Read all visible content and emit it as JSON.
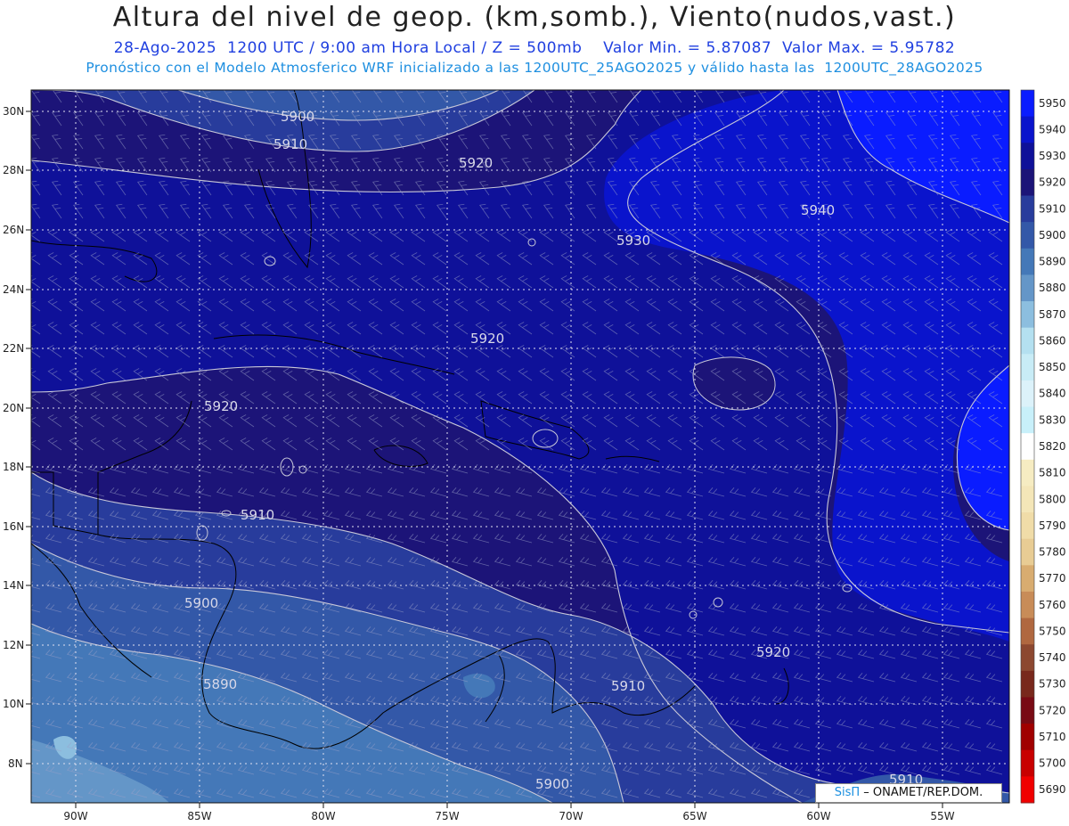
{
  "header": {
    "title": "Altura del nivel de geop. (km,somb.), Viento(nudos,vast.)",
    "subtitle": "28-Ago-2025  1200 UTC / 9:00 am Hora Local / Z = 500mb    Valor Min. = 5.87087  Valor Max. = 5.95782",
    "model_line": "Pronóstico con el Modelo Atmosferico WRF inicializado a las 1200UTC_25AGO2025 y válido hasta las  1200UTC_28AGO2025"
  },
  "axes": {
    "lat_labels": [
      "30N",
      "28N",
      "26N",
      "24N",
      "22N",
      "20N",
      "18N",
      "16N",
      "14N",
      "12N",
      "10N",
      "8N"
    ],
    "lon_labels": [
      "90W",
      "85W",
      "80W",
      "75W",
      "70W",
      "65W",
      "60W",
      "55W"
    ]
  },
  "contour_labels": [
    "5900",
    "5910",
    "5920",
    "5940",
    "5930",
    "5920",
    "5920",
    "5910",
    "5900",
    "5890",
    "5920",
    "5910",
    "5900",
    "5910"
  ],
  "colorbar": {
    "levels": [
      "5950",
      "5940",
      "5930",
      "5920",
      "5910",
      "5900",
      "5890",
      "5880",
      "5870",
      "5860",
      "5850",
      "5840",
      "5830",
      "5820",
      "5810",
      "5800",
      "5790",
      "5780",
      "5770",
      "5760",
      "5750",
      "5740",
      "5730",
      "5720",
      "5710",
      "5700",
      "5690"
    ],
    "colors": [
      "#0a1cff",
      "#0a14cc",
      "#0f1199",
      "#1c1478",
      "#283c9c",
      "#3358a8",
      "#4478b8",
      "#6496c8",
      "#8cbedf",
      "#b4e0f0",
      "#c8ecf6",
      "#dcf2fa",
      "#c8f0fa",
      "#ffffff",
      "#f6ecc2",
      "#f4e6b8",
      "#f0dca8",
      "#e8cc94",
      "#d8ac70",
      "#c88c58",
      "#b06840",
      "#8c4830",
      "#78281c",
      "#780a14",
      "#a00000",
      "#c80000",
      "#f00000"
    ]
  },
  "credit": {
    "brand": "SisΠ",
    "text": " – ONAMET/REP.DOM."
  }
}
